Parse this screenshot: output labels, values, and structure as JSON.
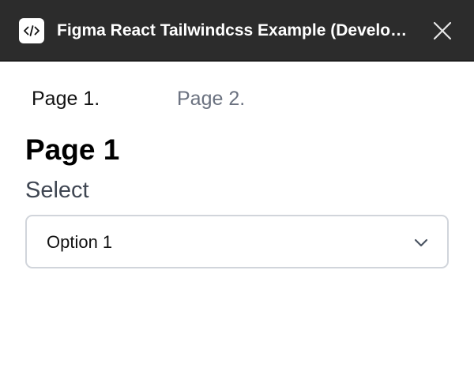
{
  "window": {
    "title": "Figma React Tailwindcss Example (Development)",
    "icon": "code-brackets-icon",
    "close_icon": "close-icon",
    "titlebar_color": "#2c2c2c"
  },
  "tabs": [
    {
      "label": "Page 1.",
      "active": true
    },
    {
      "label": "Page 2.",
      "active": false
    }
  ],
  "page": {
    "title": "Page 1",
    "select": {
      "label": "Select",
      "value": "Option 1",
      "icon": "chevron-down-icon"
    }
  }
}
